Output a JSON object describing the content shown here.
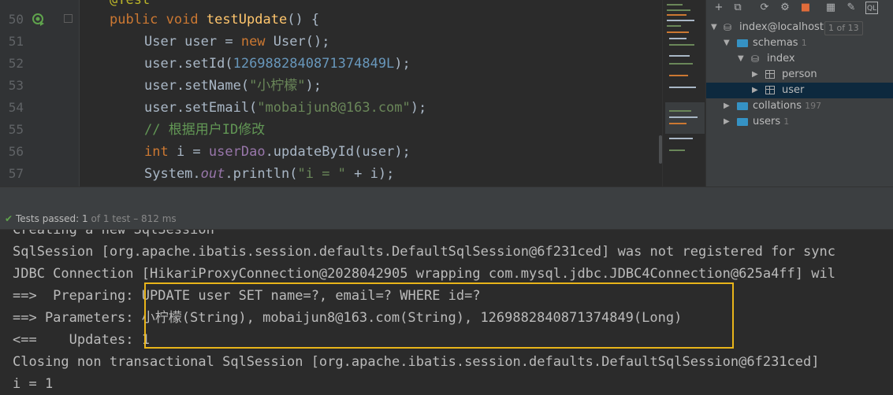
{
  "editor": {
    "lines": [
      {
        "num": "50",
        "parts": [
          {
            "t": "public ",
            "c": "kw"
          },
          {
            "t": "void ",
            "c": "kw"
          },
          {
            "t": "testUpdate",
            "c": "fn"
          },
          {
            "t": "() {",
            "c": ""
          }
        ]
      },
      {
        "num": "51",
        "parts": [
          {
            "t": "User user = ",
            "c": ""
          },
          {
            "t": "new ",
            "c": "kw"
          },
          {
            "t": "User();",
            "c": ""
          }
        ]
      },
      {
        "num": "52",
        "parts": [
          {
            "t": "user.setId(",
            "c": ""
          },
          {
            "t": "1269882840871374849L",
            "c": "num"
          },
          {
            "t": ");",
            "c": ""
          }
        ]
      },
      {
        "num": "53",
        "parts": [
          {
            "t": "user.setName(",
            "c": ""
          },
          {
            "t": "\"小柠檬\"",
            "c": "str"
          },
          {
            "t": ");",
            "c": ""
          }
        ]
      },
      {
        "num": "54",
        "parts": [
          {
            "t": "user.setEmail(",
            "c": ""
          },
          {
            "t": "\"mobaijun8@163.com\"",
            "c": "str"
          },
          {
            "t": ");",
            "c": ""
          }
        ]
      },
      {
        "num": "55",
        "parts": [
          {
            "t": "// 根据用户ID修改",
            "c": "cmt"
          }
        ]
      },
      {
        "num": "56",
        "parts": [
          {
            "t": "int ",
            "c": "kw"
          },
          {
            "t": "i = ",
            "c": ""
          },
          {
            "t": "userDao",
            "c": "ital2"
          },
          {
            "t": ".updateById(user);",
            "c": ""
          }
        ]
      },
      {
        "num": "57",
        "parts": [
          {
            "t": "System.",
            "c": ""
          },
          {
            "t": "out",
            "c": "ital"
          },
          {
            "t": ".println(",
            "c": ""
          },
          {
            "t": "\"i = \"",
            "c": "str"
          },
          {
            "t": " + i);",
            "c": ""
          }
        ]
      }
    ],
    "annotation_partial": "@Test"
  },
  "db_panel": {
    "root": {
      "label": "index@localhost",
      "badge": "1 of 13"
    },
    "schemas": {
      "label": "schemas",
      "count": "1"
    },
    "index": {
      "label": "index"
    },
    "person": {
      "label": "person"
    },
    "user": {
      "label": "user"
    },
    "collations": {
      "label": "collations",
      "count": "197"
    },
    "users": {
      "label": "users",
      "count": "1"
    }
  },
  "status": {
    "passed": "Tests passed:",
    "count": "1",
    "detail": " of 1 test – 812 ms"
  },
  "console": {
    "lines": [
      "Creating a new SqlSession",
      "SqlSession [org.apache.ibatis.session.defaults.DefaultSqlSession@6f231ced] was not registered for sync",
      "JDBC Connection [HikariProxyConnection@2028042905 wrapping com.mysql.jdbc.JDBC4Connection@625a4ff] wil",
      "==>  Preparing: UPDATE user SET name=?, email=? WHERE id=?",
      "==> Parameters: 小柠檬(String), mobaijun8@163.com(String), 1269882840871374849(Long)",
      "<==    Updates: 1",
      "Closing non transactional SqlSession [org.apache.ibatis.session.defaults.DefaultSqlSession@6f231ced]",
      "i = 1"
    ]
  },
  "colors": {
    "highlight": "#e8b41a",
    "accent_green": "#5fa34c"
  }
}
